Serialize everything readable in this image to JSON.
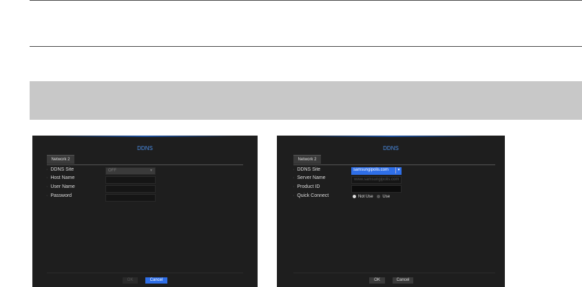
{
  "left": {
    "title": "DDNS",
    "tab": "Network 2",
    "rows": [
      {
        "label": "DDNS Site",
        "value": "OFF"
      },
      {
        "label": "Host Name",
        "value": ""
      },
      {
        "label": "User Name",
        "value": ""
      },
      {
        "label": "Password",
        "value": ""
      }
    ],
    "ok": "OK",
    "cancel": "Cancel"
  },
  "right": {
    "title": "DDNS",
    "tab": "Network 2",
    "rows": [
      {
        "label": "DDNS Site",
        "value": "samsungipolis.com"
      },
      {
        "label": "Server Name",
        "value": "www.samsungipolis.com"
      },
      {
        "label": "Product ID",
        "value": ""
      },
      {
        "label": "Quick Connect"
      }
    ],
    "radio": [
      "Not Use",
      "Use"
    ],
    "ok": "OK",
    "cancel": "Cancel"
  },
  "colors": {
    "accent": "#2f6fe8",
    "title": "#4a8ee8"
  }
}
